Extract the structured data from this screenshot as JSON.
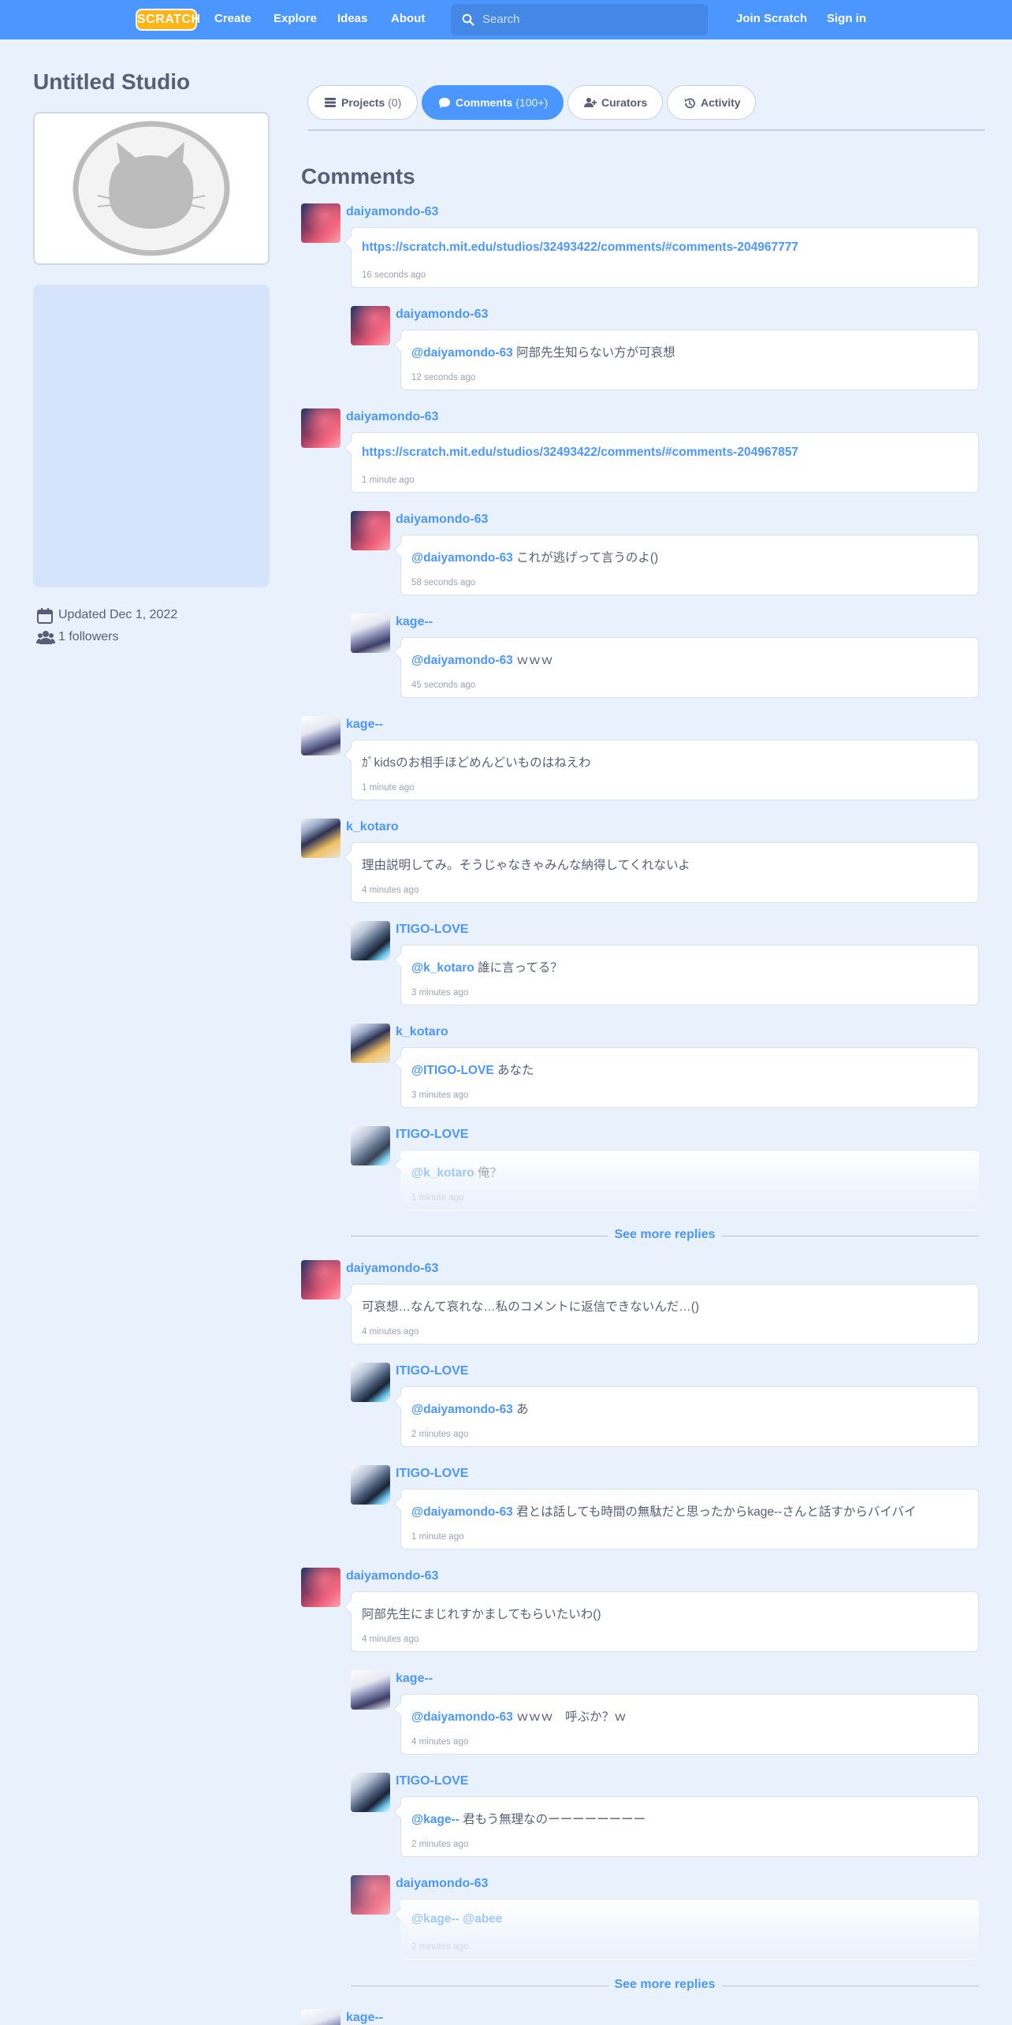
{
  "nav": {
    "logo": "SCRATCH",
    "create": "Create",
    "explore": "Explore",
    "ideas": "Ideas",
    "about": "About",
    "search_placeholder": "Search",
    "join": "Join Scratch",
    "signin": "Sign in"
  },
  "studio": {
    "title": "Untitled Studio",
    "updated": "Updated Dec 1, 2022",
    "followers": "1 followers"
  },
  "tabs": {
    "projects_label": "Projects",
    "projects_count": "(0)",
    "comments_label": "Comments",
    "comments_count": "(100+)",
    "curators_label": "Curators",
    "activity_label": "Activity"
  },
  "comments_heading": "Comments",
  "see_more_label": "See more replies",
  "comments": [
    {
      "user": "daiyamondo-63",
      "mention": "",
      "text": "https://scratch.mit.edu/studios/32493422/comments/#comments-204967777",
      "time": "16 seconds ago"
    },
    {
      "user": "daiyamondo-63",
      "mention": "@daiyamondo-63",
      "text": " 阿部先生知らない方が可哀想",
      "time": "12 seconds ago"
    },
    {
      "user": "daiyamondo-63",
      "mention": "",
      "text": "https://scratch.mit.edu/studios/32493422/comments/#comments-204967857",
      "time": "1 minute ago"
    },
    {
      "user": "daiyamondo-63",
      "mention": "@daiyamondo-63",
      "text": " これが逃げって言うのよ()",
      "time": "58 seconds ago"
    },
    {
      "user": "kage--",
      "mention": "@daiyamondo-63",
      "text": " ｗｗｗ",
      "time": "45 seconds ago"
    },
    {
      "user": "kage--",
      "mention": "",
      "text": "ｶﾞkidsのお相手ほどめんどいものはねえわ",
      "time": "1 minute ago"
    },
    {
      "user": "k_kotaro",
      "mention": "",
      "text": "理由説明してみ。そうじゃなきゃみんな納得してくれないよ",
      "time": "4 minutes ago"
    },
    {
      "user": "ITIGO-LOVE",
      "mention": "@k_kotaro",
      "text": " 誰に言ってる？",
      "time": "3 minutes ago"
    },
    {
      "user": "k_kotaro",
      "mention": "@ITIGO-LOVE",
      "text": " あなた",
      "time": "3 minutes ago"
    },
    {
      "user": "ITIGO-LOVE",
      "mention": "@k_kotaro",
      "text": " 俺？",
      "time": "1 minute ago"
    },
    {
      "user": "daiyamondo-63",
      "mention": "",
      "text": "可哀想…なんて哀れな…私のコメントに返信できないんだ…()",
      "time": "4 minutes ago"
    },
    {
      "user": "ITIGO-LOVE",
      "mention": "@daiyamondo-63",
      "text": " あ",
      "time": "2 minutes ago"
    },
    {
      "user": "ITIGO-LOVE",
      "mention": "@daiyamondo-63",
      "text": " 君とは話しても時間の無駄だと思ったからkage--さんと話すからバイバイ",
      "time": "1 minute ago"
    },
    {
      "user": "daiyamondo-63",
      "mention": "",
      "text": "阿部先生にまじれすかましてもらいたいわ()",
      "time": "4 minutes ago"
    },
    {
      "user": "kage--",
      "mention": "@daiyamondo-63",
      "text": " ｗｗｗ　呼ぶか？ｗ",
      "time": "4 minutes ago"
    },
    {
      "user": "ITIGO-LOVE",
      "mention": "@kage--",
      "text": " 君もう無理なのーーーーーーーー",
      "time": "2 minutes ago"
    },
    {
      "user": "daiyamondo-63",
      "mention": "@kage--",
      "text": " @abee",
      "time": "2 minutes ago"
    },
    {
      "user": "kage--",
      "mention": "",
      "text": "",
      "time": ""
    }
  ],
  "colors": {
    "accent": "#4c97ff",
    "page_bg": "#e9f1fc",
    "text": "#575e75"
  }
}
